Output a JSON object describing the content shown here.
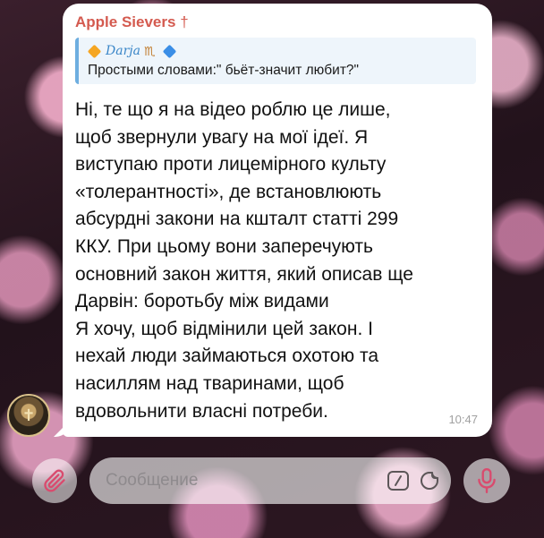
{
  "message": {
    "sender": "Apple Sievers",
    "sender_mark": "†",
    "reply": {
      "author": "Darja",
      "text": "Простыми словами:\" бьёт-значит любит?\""
    },
    "lines": [
      "Ні, те що я на відео роблю це лише,",
      "щоб звернули увагу на мої ідеї. Я",
      "виступаю проти лицемірного культу",
      "«толерантності», де встановлюють",
      "абсурдні закони на кшталт статті 299",
      "ККУ. При цьому вони заперечують",
      "основний закон життя, який описав ще",
      "Дарвін: боротьбу між видами",
      "Я хочу, щоб відмінили цей закон. І",
      "нехай люди займаються охотою та",
      "насиллям над тваринами, щоб",
      "вдовольнити власні потреби."
    ],
    "time": "10:47"
  },
  "composer": {
    "placeholder": "Сообщение"
  },
  "icons": {
    "attach": "paperclip-icon",
    "commands": "command-icon",
    "sticker": "sticker-icon",
    "mic": "microphone-icon"
  },
  "colors": {
    "sender": "#d45a4f",
    "quote_accent": "#6eaee0",
    "quote_author": "#3a86c8"
  }
}
